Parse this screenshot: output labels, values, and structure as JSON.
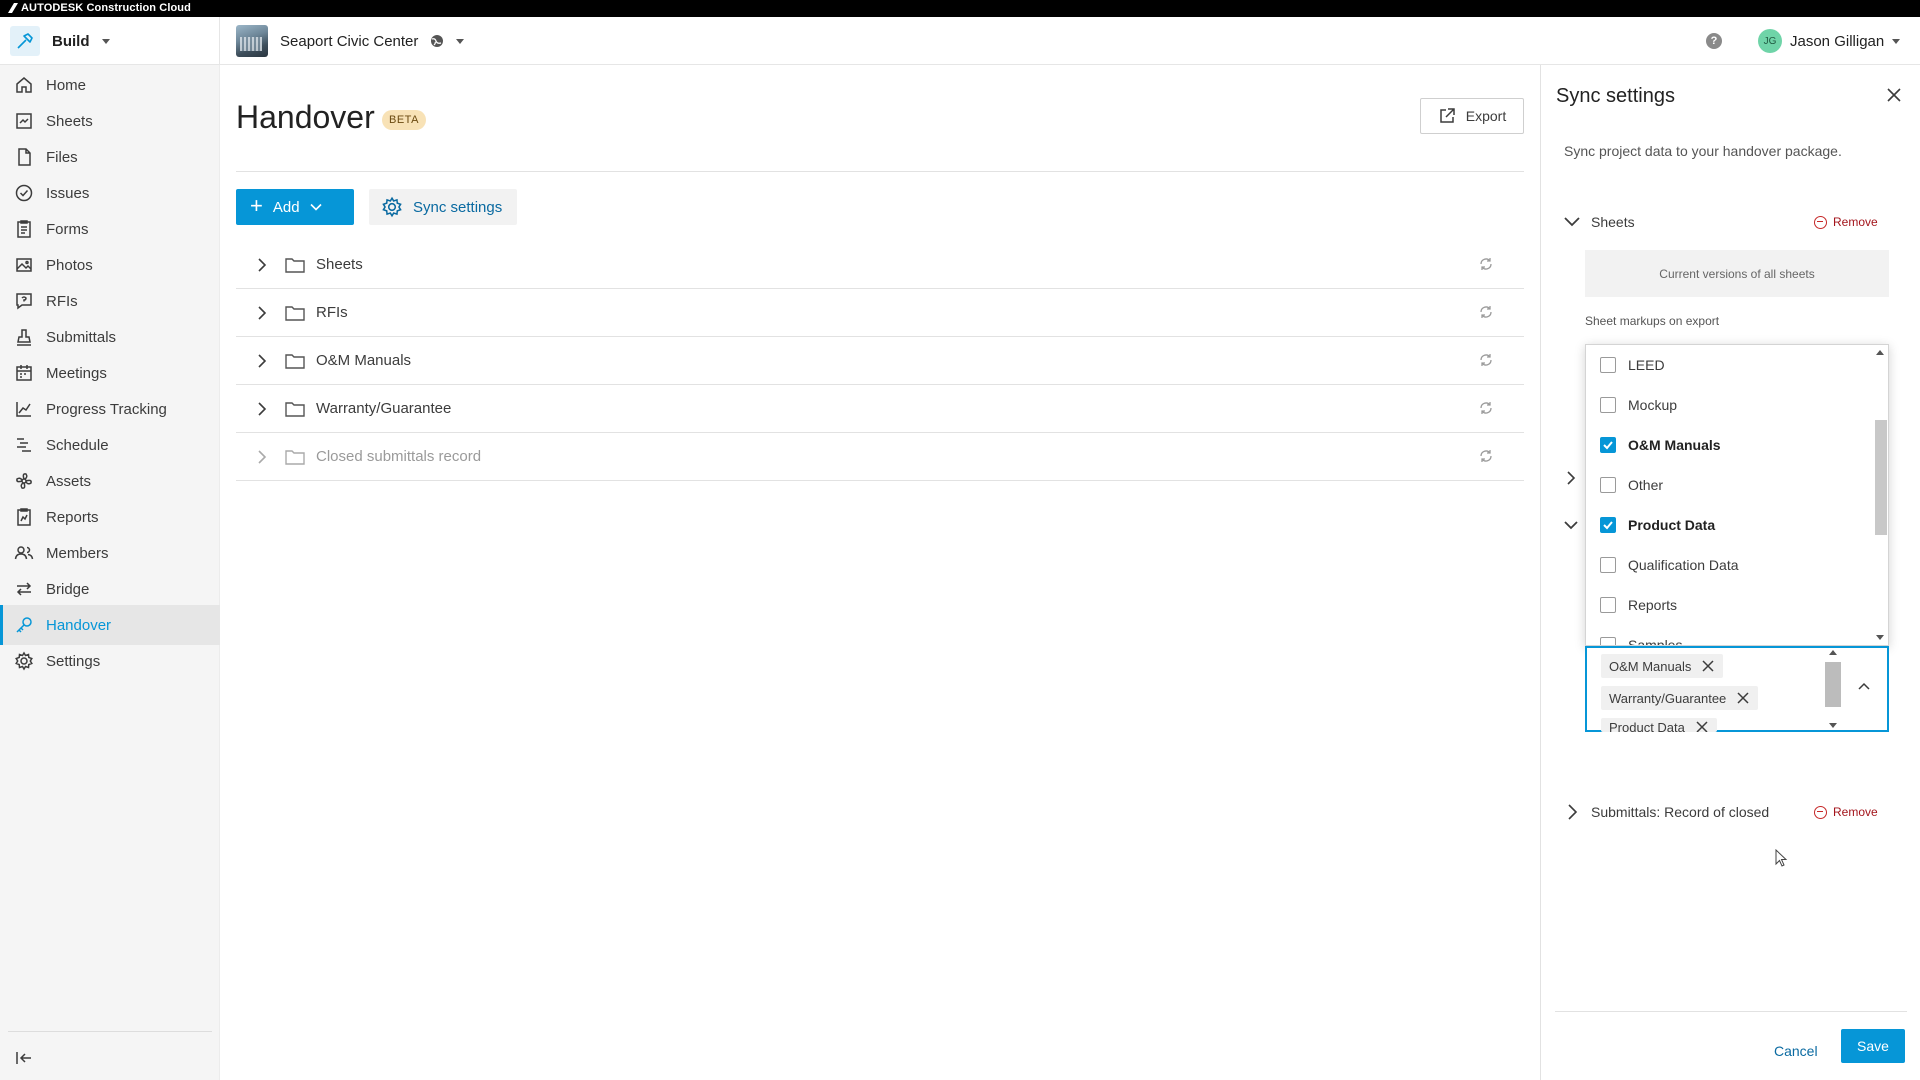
{
  "topbar": {
    "brand": "AUTODESK Construction Cloud"
  },
  "header": {
    "module": "Build",
    "project": "Seaport Civic Center",
    "help": "?",
    "user": {
      "initials": "JG",
      "name": "Jason Gilligan"
    }
  },
  "sidebar": {
    "items": [
      {
        "label": "Home",
        "icon": "home-icon"
      },
      {
        "label": "Sheets",
        "icon": "sheets-icon"
      },
      {
        "label": "Files",
        "icon": "files-icon"
      },
      {
        "label": "Issues",
        "icon": "issues-icon"
      },
      {
        "label": "Forms",
        "icon": "forms-icon"
      },
      {
        "label": "Photos",
        "icon": "photos-icon"
      },
      {
        "label": "RFIs",
        "icon": "rfis-icon"
      },
      {
        "label": "Submittals",
        "icon": "submittals-icon"
      },
      {
        "label": "Meetings",
        "icon": "meetings-icon"
      },
      {
        "label": "Progress Tracking",
        "icon": "progress-icon"
      },
      {
        "label": "Schedule",
        "icon": "schedule-icon"
      },
      {
        "label": "Assets",
        "icon": "assets-icon"
      },
      {
        "label": "Reports",
        "icon": "reports-icon"
      },
      {
        "label": "Members",
        "icon": "members-icon"
      },
      {
        "label": "Bridge",
        "icon": "bridge-icon"
      },
      {
        "label": "Handover",
        "icon": "handover-icon",
        "active": true
      },
      {
        "label": "Settings",
        "icon": "settings-icon"
      }
    ]
  },
  "main": {
    "title": "Handover",
    "badge": "BETA",
    "export_label": "Export",
    "add_label": "Add",
    "sync_label": "Sync settings",
    "folders": [
      {
        "label": "Sheets",
        "disabled": false
      },
      {
        "label": "RFIs",
        "disabled": false
      },
      {
        "label": "O&M Manuals",
        "disabled": false
      },
      {
        "label": "Warranty/Guarantee",
        "disabled": false
      },
      {
        "label": "Closed submittals record",
        "disabled": true
      }
    ]
  },
  "panel": {
    "title": "Sync settings",
    "description": "Sync project data to your handover package.",
    "sheets_section": "Sheets",
    "remove_label": "Remove",
    "versions_text": "Current versions of all sheets",
    "markups_label": "Sheet markups on export",
    "dropdown_options": [
      {
        "label": "LEED",
        "checked": false
      },
      {
        "label": "Mockup",
        "checked": false
      },
      {
        "label": "O&M Manuals",
        "checked": true
      },
      {
        "label": "Other",
        "checked": false
      },
      {
        "label": "Product Data",
        "checked": true
      },
      {
        "label": "Qualification Data",
        "checked": false
      },
      {
        "label": "Reports",
        "checked": false
      },
      {
        "label": "Samples",
        "checked": false
      }
    ],
    "selected_tags": [
      "O&M Manuals",
      "Warranty/Guarantee",
      "Product Data"
    ],
    "submittals_section": "Submittals: Record of closed",
    "cancel_label": "Cancel",
    "save_label": "Save"
  },
  "colors": {
    "accent": "#0696d7",
    "remove": "#a3141b",
    "beta": "#f8e2b6"
  }
}
